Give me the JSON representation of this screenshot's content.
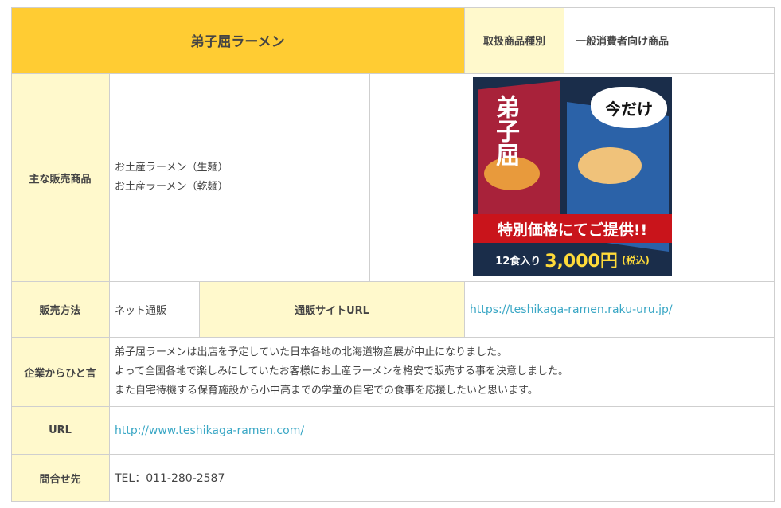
{
  "title": "弟子屈ラーメン",
  "category": {
    "label": "取扱商品種別",
    "value": "一般消費者向け商品"
  },
  "products": {
    "label": "主な販売商品",
    "items": [
      "お土産ラーメン（生麺）",
      "お土産ラーメン（乾麺）"
    ],
    "image": {
      "brand": "弟子屈",
      "badge": "今だけ",
      "banner": "特別価格にてご提供!!",
      "quantity": "12食入り",
      "price": "3,000円",
      "tax": "(税込)"
    }
  },
  "sales_method": {
    "label": "販売方法",
    "value": "ネット通販",
    "site_label": "通販サイトURL",
    "site_url": "https://teshikaga-ramen.raku-uru.jp/"
  },
  "message": {
    "label": "企業からひと言",
    "lines": [
      "弟子屈ラーメンは出店を予定していた日本各地の北海道物産展が中止になりました。",
      "よって全国各地で楽しみにしていたお客様にお土産ラーメンを格安で販売する事を決意しました。",
      "また自宅待機する保育施設から小中高までの学童の自宅での食事を応援したいと思います。"
    ]
  },
  "url": {
    "label": "URL",
    "value": "http://www.teshikaga-ramen.com/"
  },
  "contact": {
    "label": "問合せ先",
    "value": "TEL：011-280-2587"
  },
  "colors": {
    "title_bg": "#ffcc33",
    "header_bg": "#fff9cc",
    "link": "#3aa7c5",
    "border": "#cfcfcf"
  }
}
